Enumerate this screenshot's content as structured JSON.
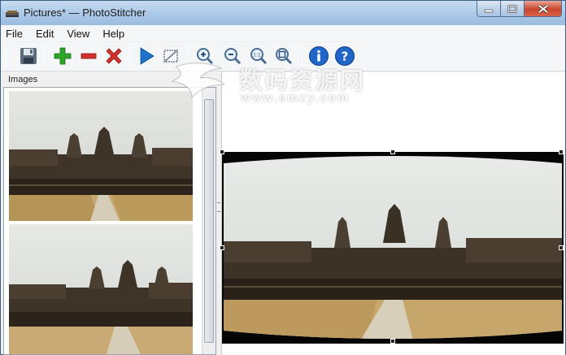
{
  "window": {
    "title": "Pictures* — PhotoStitcher"
  },
  "menu": {
    "items": [
      {
        "label": "File"
      },
      {
        "label": "Edit"
      },
      {
        "label": "View"
      },
      {
        "label": "Help"
      }
    ]
  },
  "toolbar": {
    "buttons": [
      {
        "icon": "save-icon"
      },
      {
        "icon": "add-icon",
        "color": "#2fa52a"
      },
      {
        "icon": "remove-icon",
        "color": "#d2322b"
      },
      {
        "icon": "delete-icon",
        "color": "#d2322b"
      },
      {
        "icon": "play-icon",
        "color": "#1d73c9"
      },
      {
        "icon": "crop-icon"
      },
      {
        "icon": "zoom-in-icon"
      },
      {
        "icon": "zoom-out-icon"
      },
      {
        "icon": "zoom-actual-icon"
      },
      {
        "icon": "zoom-fit-icon"
      },
      {
        "icon": "info-icon",
        "color": "#1f66c8"
      },
      {
        "icon": "help-icon",
        "color": "#1f66c8"
      }
    ]
  },
  "images_panel": {
    "header": "Images",
    "thumbnails": [
      {
        "subject": "temple-photo-1"
      },
      {
        "subject": "temple-photo-2"
      }
    ]
  },
  "watermark": {
    "title": "数码资源网",
    "url": "www.smzy.com"
  }
}
